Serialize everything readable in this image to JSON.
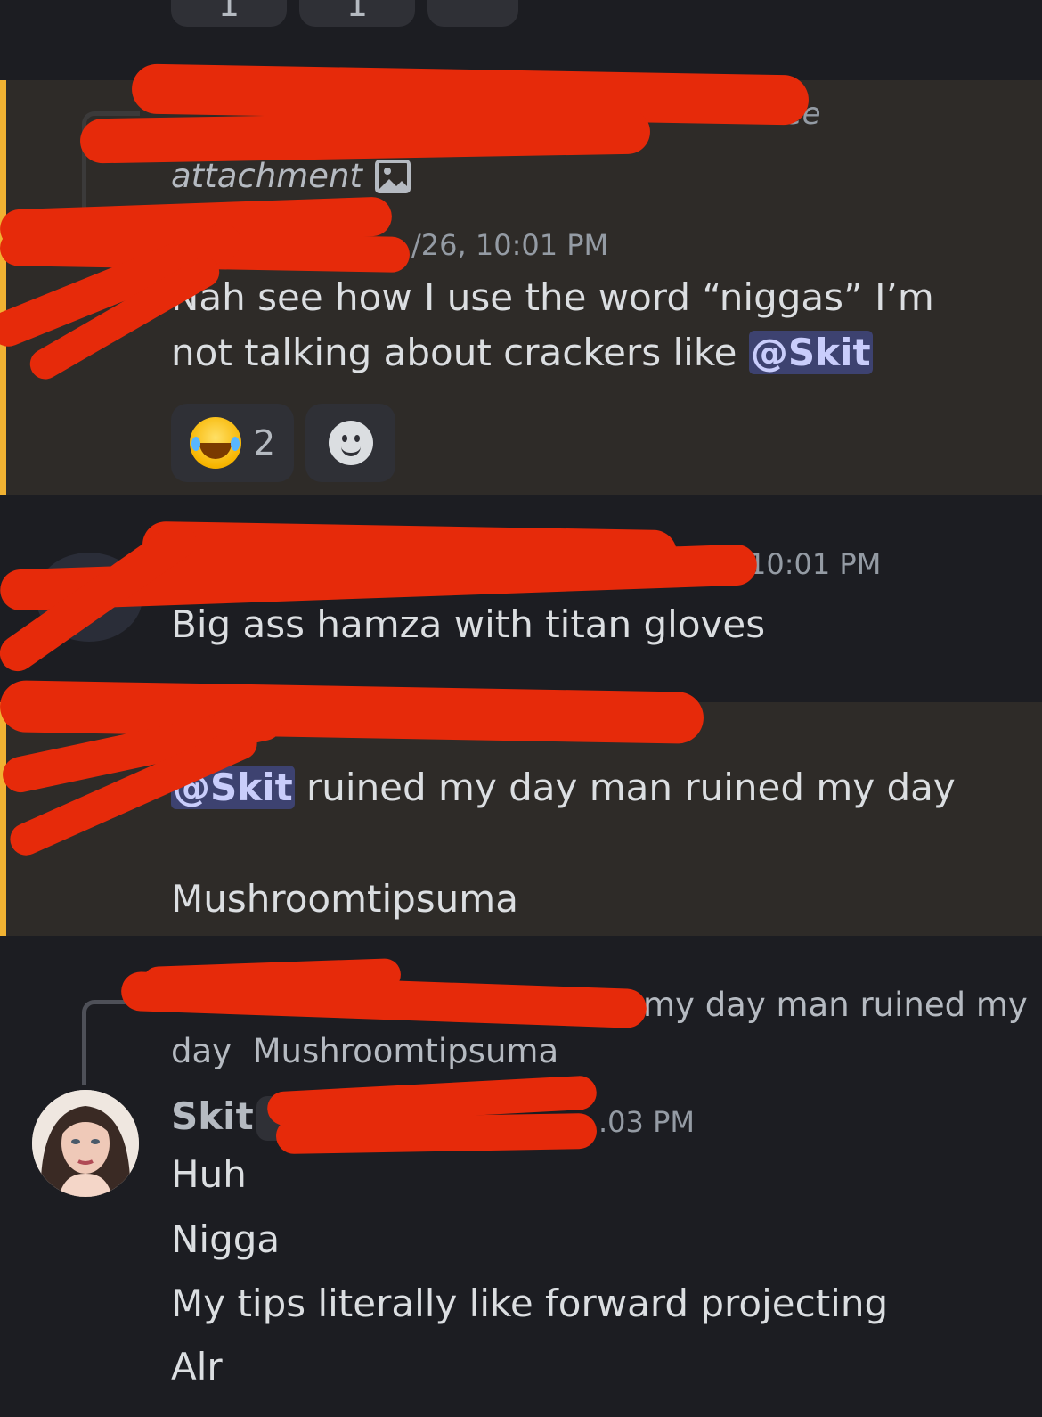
{
  "top_reactions": {
    "count_1": "1",
    "count_2": "1"
  },
  "msg1": {
    "reply_tail": "see",
    "reply_attachment": "attachment",
    "timestamp": "/26, 10:01 PM",
    "text_before": "Nah see how I use the word “niggas” I’m not talking about crackers like ",
    "mention": "@Skit",
    "reaction_count": "2"
  },
  "msg2": {
    "timestamp": "10:01 PM",
    "text": "Big ass hamza with titan gloves"
  },
  "msg3": {
    "mention": "@Skit",
    "line1_rest": " ruined my day man ruined my day",
    "line2": "Mushroomtipsuma"
  },
  "msg4": {
    "reply_line1": "my day man ruined my",
    "reply_line2": "day  Mushroomtipsuma",
    "author": "Skit",
    "timestamp_tail": ".03 PM",
    "lines": [
      "Huh",
      "Nigga",
      "My tips literally like forward projecting",
      "Alr"
    ]
  }
}
